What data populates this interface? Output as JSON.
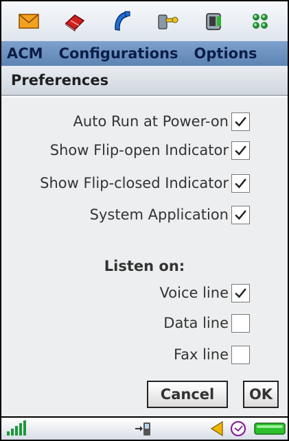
{
  "toolbar": {
    "icons": [
      "envelope-icon",
      "book-icon",
      "phone-handset-icon",
      "tools-icon",
      "sim-card-icon",
      "apps-grid-icon"
    ]
  },
  "menu": {
    "items": [
      "ACM",
      "Configurations",
      "Options"
    ]
  },
  "dialog": {
    "title": "Preferences"
  },
  "preferences": [
    {
      "label": "Auto Run at Power-on",
      "checked": true
    },
    {
      "label": "Show Flip-open Indicator",
      "checked": true
    },
    {
      "label": "Show Flip-closed Indicator",
      "checked": true
    },
    {
      "label": "System Application",
      "checked": true
    }
  ],
  "listen": {
    "heading": "Listen on:",
    "options": [
      {
        "label": "Voice line",
        "checked": true
      },
      {
        "label": "Data line",
        "checked": false
      },
      {
        "label": "Fax line",
        "checked": false
      }
    ]
  },
  "buttons": {
    "cancel": "Cancel",
    "ok": "OK"
  },
  "status": {
    "icons": [
      "signal-strength-icon",
      "phone-link-icon",
      "volume-icon",
      "clock-icon",
      "battery-icon"
    ]
  }
}
